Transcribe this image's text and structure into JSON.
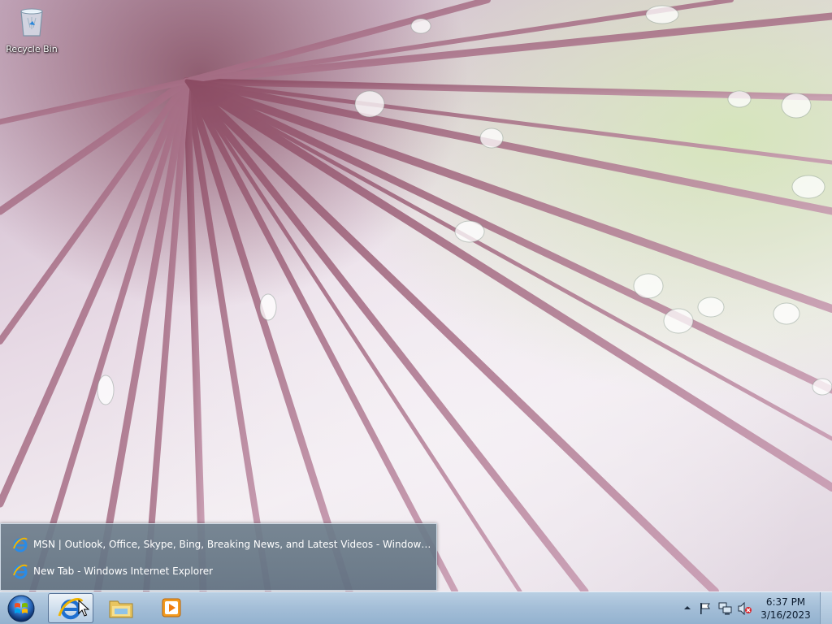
{
  "desktop": {
    "icons": [
      {
        "label": "Recycle Bin",
        "icon": "recycle-bin-icon"
      }
    ]
  },
  "ie_popup": {
    "items": [
      {
        "label": "MSN | Outlook, Office, Skype, Bing, Breaking News, and Latest Videos - Windows Internet E...",
        "icon": "internet-explorer-icon"
      },
      {
        "label": "New Tab - Windows Internet Explorer",
        "icon": "internet-explorer-icon"
      }
    ]
  },
  "taskbar": {
    "start_icon": "windows-start-orb-icon",
    "pinned": [
      {
        "name": "Internet Explorer",
        "icon": "internet-explorer-icon",
        "active": true
      },
      {
        "name": "Windows Explorer",
        "icon": "folder-icon",
        "active": false
      },
      {
        "name": "Windows Media Player",
        "icon": "media-player-icon",
        "active": false
      }
    ],
    "tray": {
      "icons": [
        "show-hidden-icons-arrow",
        "action-center-flag-icon",
        "network-icon",
        "volume-muted-icon"
      ],
      "time": "6:37 PM",
      "date": "3/16/2023"
    }
  },
  "colors": {
    "taskbar": "#a5bfd8",
    "popup": "#6e7e8c",
    "ie_blue": "#1e6fd0",
    "ie_gold": "#f0b400"
  }
}
